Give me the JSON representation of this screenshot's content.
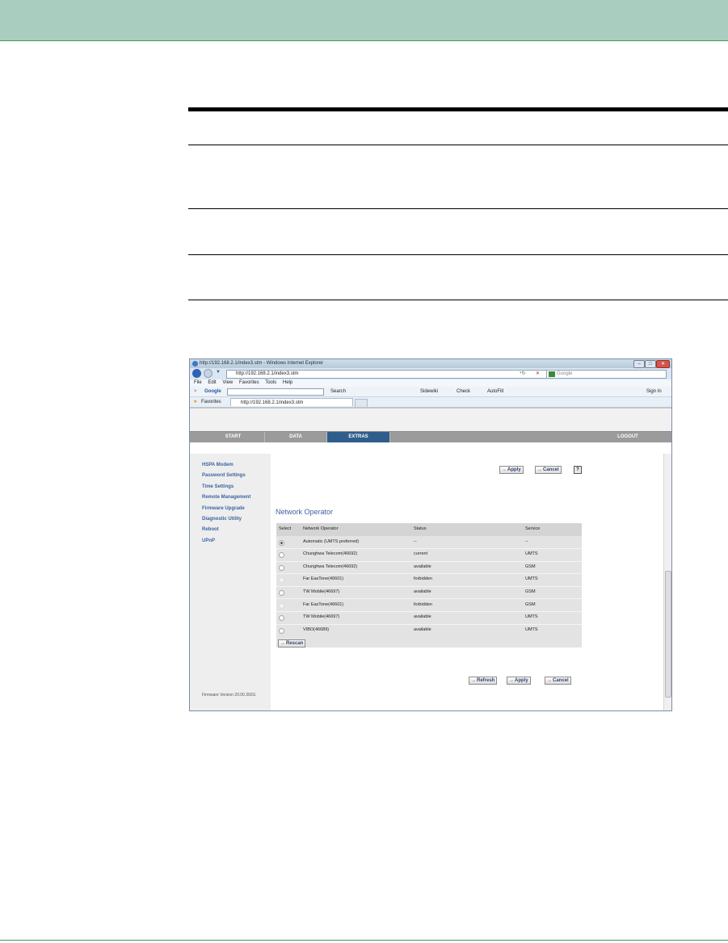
{
  "browser": {
    "title": "http://192.168.2.1/index3.stm - Windows Internet Explorer",
    "address": "http://192.168.2.1/index3.stm",
    "search_placeholder": "Google",
    "menu": [
      "File",
      "Edit",
      "View",
      "Favorites",
      "Tools",
      "Help"
    ],
    "toolbar": {
      "google_label": "Google",
      "search": "Search",
      "sidewiki": "Sidewiki",
      "check": "Check",
      "autofill": "AutoFill",
      "sign_in": "Sign In"
    },
    "favorites": "Favorites",
    "tab_title": "http://192.168.2.1/index3.stm"
  },
  "nav": {
    "tabs": [
      "START",
      "DATA",
      "EXTRAS"
    ],
    "logout": "LOGOUT",
    "active": "EXTRAS"
  },
  "sidebar": {
    "items": [
      "HSPA Modem",
      "Password Settings",
      "Time Settings",
      "Remote Management",
      "Firmware Upgrade",
      "Diagnostic Utility",
      "Reboot",
      "UPnP"
    ],
    "firmware": "Firmware Version 20.00.392G"
  },
  "buttons": {
    "apply": "Apply",
    "cancel": "Cancel",
    "help": "?",
    "rescan": "Rescan",
    "refresh": "Refresh"
  },
  "section_title": "Network Operator",
  "table": {
    "headers": [
      "Select",
      "Network Operator",
      "Status",
      "Service"
    ],
    "rows": [
      {
        "operator": "Automatic (UMTS preferred)",
        "status": "--",
        "service": "--"
      },
      {
        "operator": "Chunghwa Telecom(46692)",
        "status": "current",
        "service": "UMTS"
      },
      {
        "operator": "Chunghwa Telecom(46692)",
        "status": "available",
        "service": "GSM"
      },
      {
        "operator": "Far EasTone(46601)",
        "status": "forbidden",
        "service": "UMTS"
      },
      {
        "operator": "TW Mobile(46697)",
        "status": "available",
        "service": "GSM"
      },
      {
        "operator": "Far EasTone(46601)",
        "status": "forbidden",
        "service": "GSM"
      },
      {
        "operator": "TW Mobile(46697)",
        "status": "available",
        "service": "UMTS"
      },
      {
        "operator": "VIBO(46689)",
        "status": "available",
        "service": "UMTS"
      }
    ]
  }
}
